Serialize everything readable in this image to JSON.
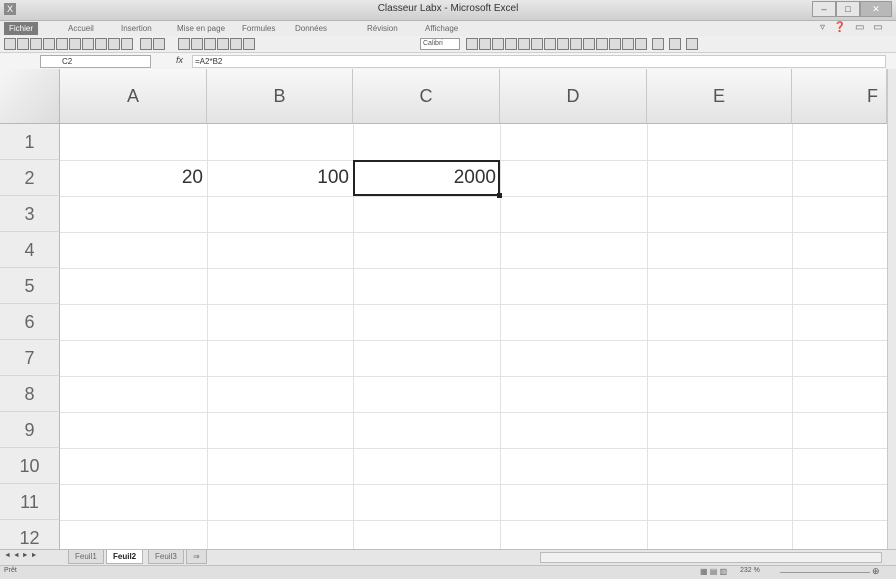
{
  "window": {
    "title": "Classeur Labx - Microsoft Excel",
    "app_icon": "X"
  },
  "ribbon": {
    "tabs": [
      "Fichier",
      "Accueil",
      "Insertion",
      "Mise en page",
      "Formules",
      "Données",
      "Révision",
      "Affichage"
    ],
    "font_name": "Calibri"
  },
  "formula_bar": {
    "name_box": "C2",
    "fx": "fx",
    "formula": "=A2*B2"
  },
  "grid": {
    "columns": [
      "A",
      "B",
      "C",
      "D",
      "E",
      "F"
    ],
    "rows": [
      "1",
      "2",
      "3",
      "4",
      "5",
      "6",
      "7",
      "8",
      "9",
      "10",
      "11",
      "12"
    ],
    "cells": {
      "A2": "20",
      "B2": "100",
      "C2": "2000"
    },
    "active_cell": "C2"
  },
  "sheets": {
    "tabs": [
      "Feuil1",
      "Feuil2",
      "Feuil3"
    ],
    "active": "Feuil2"
  },
  "status": {
    "text": "Prêt",
    "zoom": "232 %"
  }
}
